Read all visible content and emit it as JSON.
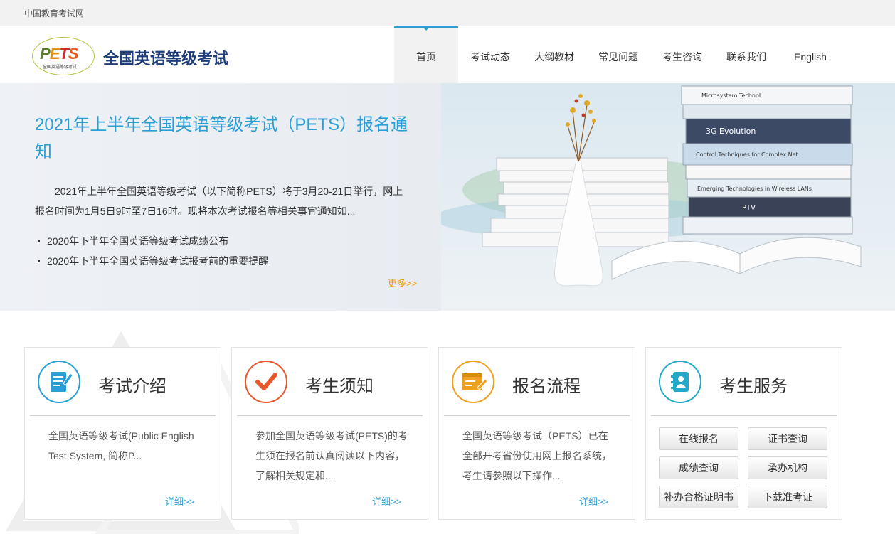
{
  "topbar": {
    "site": "中国教育考试网"
  },
  "header": {
    "logo_text": "PETS",
    "logo_sub": "全国英语等级考试",
    "title": "全国英语等级考试"
  },
  "nav": [
    {
      "label": "首页",
      "active": true
    },
    {
      "label": "考试动态"
    },
    {
      "label": "大纲教材"
    },
    {
      "label": "常见问题"
    },
    {
      "label": "考生咨询"
    },
    {
      "label": "联系我们"
    },
    {
      "label": "English"
    }
  ],
  "banner": {
    "headline": "2021年上半年全国英语等级考试（PETS）报名通知",
    "lead": "2021年上半年全国英语等级考试（以下简称PETS）将于3月20-21日举行，网上报名时间为1月5日9时至7日16时。现将本次考试报名等相关事宜通知如...",
    "news": [
      "2020年下半年全国英语等级考试成绩公布",
      "2020年下半年全国英语等级考试报考前的重要提醒"
    ],
    "more": "更多>>",
    "book_spines": [
      "Microsystem Technol",
      "3G Evolution",
      "Control Techniques for Complex Net",
      "Emerging Technologies in Wireless LANs",
      "IPTV"
    ]
  },
  "cards": [
    {
      "title": "考试介绍",
      "icon": "document-edit-icon",
      "color": "#2a9fd6",
      "desc": "全国英语等级考试(Public English Test System, 简称P...",
      "detail": "详细>>"
    },
    {
      "title": "考生须知",
      "icon": "checkmark-icon",
      "color": "#e8572b",
      "desc": "参加全国英语等级考试(PETS)的考生须在报名前认真阅读以下内容，了解相关规定和...",
      "detail": "详细>>"
    },
    {
      "title": "报名流程",
      "icon": "form-edit-icon",
      "color": "#f0a020",
      "desc": "全国英语等级考试（PETS）已在全部开考省份使用网上报名系统，考生请参照以下操作...",
      "detail": "详细>>"
    },
    {
      "title": "考生服务",
      "icon": "contact-book-icon",
      "color": "#22a8c8",
      "services": [
        "在线报名",
        "证书查询",
        "成绩查询",
        "承办机构",
        "补办合格证明书",
        "下载准考证"
      ]
    }
  ]
}
